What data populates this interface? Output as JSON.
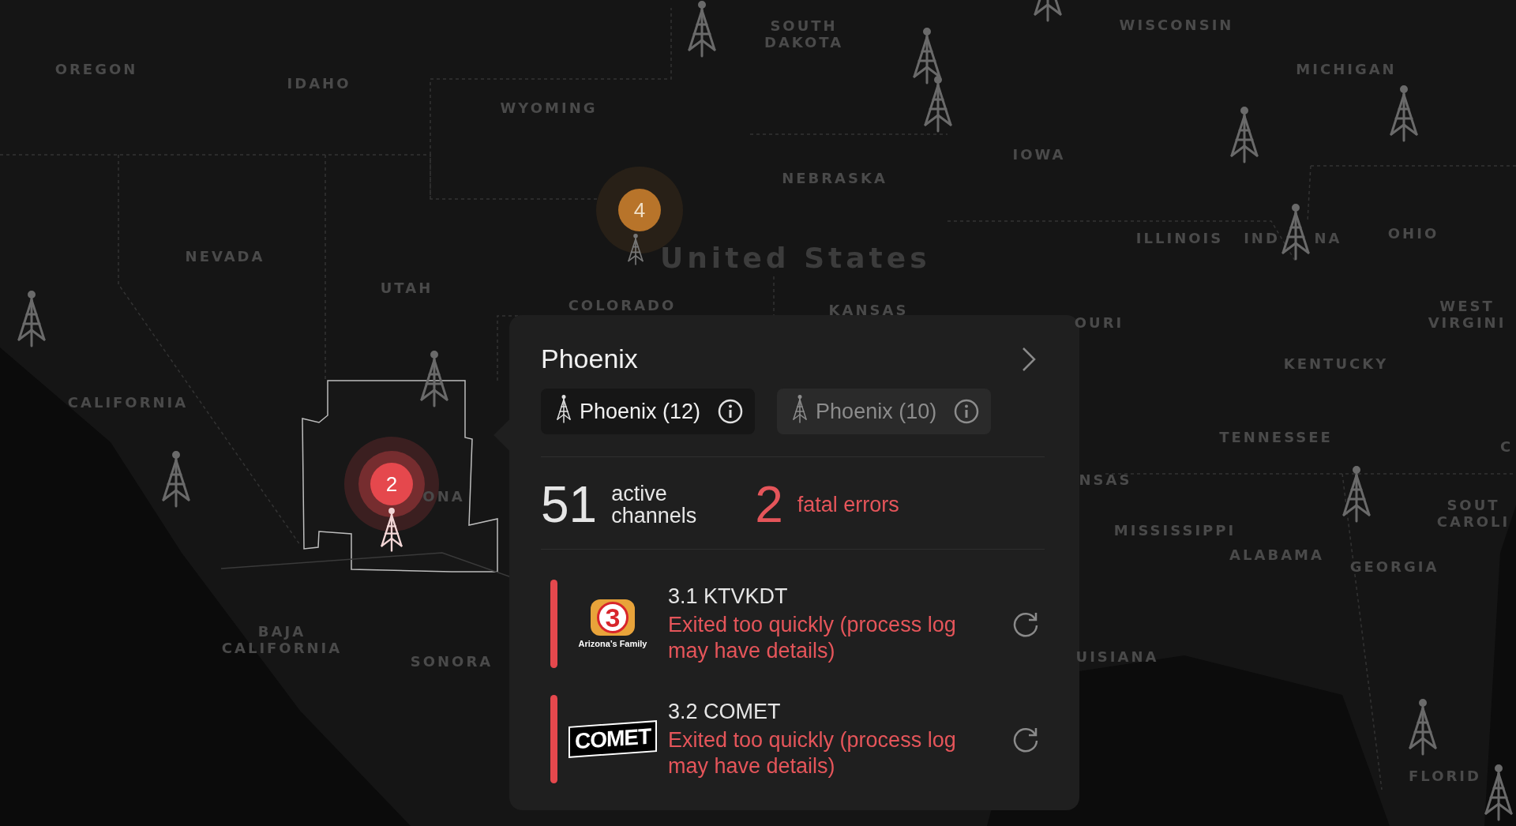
{
  "map": {
    "labels": [
      {
        "text": "OREGON"
      },
      {
        "text": "IDAHO"
      },
      {
        "text": "WYOMING"
      },
      {
        "text": "SOUTH DAKOTA"
      },
      {
        "text": "WISCONSIN"
      },
      {
        "text": "MICHIGAN"
      },
      {
        "text": "IOWA"
      },
      {
        "text": "NEBRASKA"
      },
      {
        "text": "ILLINOIS"
      },
      {
        "text": "IND"
      },
      {
        "text": "NA"
      },
      {
        "text": "OHIO"
      },
      {
        "text": "NEVADA"
      },
      {
        "text": "UTAH"
      },
      {
        "text": "COLORADO"
      },
      {
        "text": "KANSAS"
      },
      {
        "text": "OURI"
      },
      {
        "text": "WEST VIRGINI"
      },
      {
        "text": "KENTUCKY"
      },
      {
        "text": "CALIFORNIA"
      },
      {
        "text": "TENNESSEE"
      },
      {
        "text": "C"
      },
      {
        "text": "NSAS"
      },
      {
        "text": "MISSISSIPPI"
      },
      {
        "text": "ALABAMA"
      },
      {
        "text": "GEORGIA"
      },
      {
        "text": "ONA"
      },
      {
        "text": "SOUT CAROLI"
      },
      {
        "text": "BAJA CALIFORNIA"
      },
      {
        "text": "SONORA"
      },
      {
        "text": "UISIANA"
      },
      {
        "text": "FLORID"
      }
    ],
    "country_label": "United States",
    "clusters": [
      {
        "count": "4",
        "color": "#b8742a",
        "selected": false
      },
      {
        "count": "2",
        "color": "#e5484d",
        "selected": true
      }
    ]
  },
  "popup": {
    "title": "Phoenix",
    "tabs": [
      {
        "label": "Phoenix (12)",
        "selected": true
      },
      {
        "label": "Phoenix (10)",
        "selected": false
      }
    ],
    "stats": [
      {
        "value": "51",
        "label": "active channels",
        "kind": "normal"
      },
      {
        "value": "2",
        "label": "fatal errors",
        "kind": "error"
      }
    ],
    "channels": [
      {
        "name": "3.1 KTVKDT",
        "message": "Exited too quickly (process log may have details)",
        "color": "#e5484d",
        "logo": {
          "kind": "badge",
          "mark": "3",
          "caption": "Arizona’s Family"
        }
      },
      {
        "name": "3.2 COMET",
        "message": "Exited too quickly (process log may have details)",
        "color": "#e5484d",
        "logo": {
          "kind": "wordmark",
          "mark": "COMET"
        }
      }
    ]
  }
}
